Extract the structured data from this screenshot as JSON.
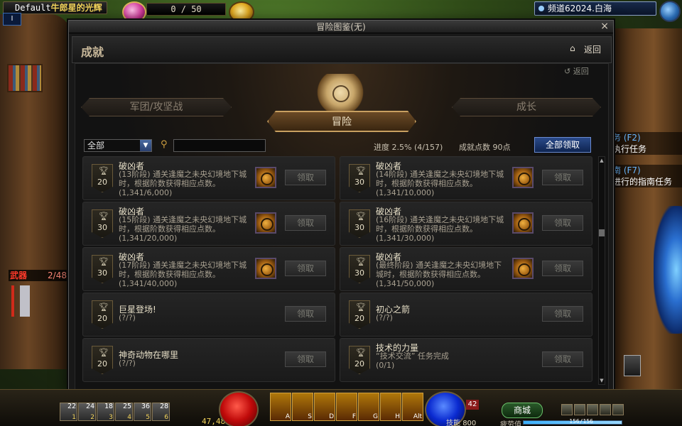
{
  "hud": {
    "player_name": "Default",
    "player_title": "牛郎星的光辉",
    "level": "I",
    "fatigue": "0 / 50",
    "channel": "频道62024.白海"
  },
  "quest": {
    "header1": "务 (F2)",
    "text1": "执行任务",
    "header2": "南 (F7)",
    "text2": "进行的指南任务"
  },
  "weapon": {
    "label": "武器",
    "count": "2/48"
  },
  "window": {
    "title": "冒险图鉴(无)",
    "close": "×",
    "section": "成就",
    "back": "返回",
    "back_small": "返回"
  },
  "categories": {
    "left": "军团/攻坚战",
    "center": "冒险",
    "right": "成长"
  },
  "filter": {
    "selected": "全部",
    "search_placeholder": ""
  },
  "progress": {
    "label": "进度",
    "percent": "2.5%",
    "fraction": "(4/157)",
    "points_label": "成就点数",
    "points": "90点"
  },
  "claim_all": "全部领取",
  "achievements": [
    {
      "name": "破凶者",
      "desc": "(13阶段) 通关逢魔之未央幻境地下城时，根据阶数获得相应点数。",
      "progress": "(1,341/6,000)",
      "points": "20",
      "has_reward": true,
      "claim": "领取"
    },
    {
      "name": "破凶者",
      "desc": "(14阶段) 通关逢魔之未央幻境地下城时，根据阶数获得相应点数。",
      "progress": "(1,341/10,000)",
      "points": "30",
      "has_reward": true,
      "claim": "领取"
    },
    {
      "name": "破凶者",
      "desc": "(15阶段) 通关逢魔之未央幻境地下城时，根据阶数获得相应点数。",
      "progress": "(1,341/20,000)",
      "points": "30",
      "has_reward": true,
      "claim": "领取"
    },
    {
      "name": "破凶者",
      "desc": "(16阶段) 通关逢魔之未央幻境地下城时，根据阶数获得相应点数。",
      "progress": "(1,341/30,000)",
      "points": "30",
      "has_reward": true,
      "claim": "领取"
    },
    {
      "name": "破凶者",
      "desc": "(17阶段) 通关逢魔之未央幻境地下城时，根据阶数获得相应点数。",
      "progress": "(1,341/40,000)",
      "points": "30",
      "has_reward": true,
      "claim": "领取"
    },
    {
      "name": "破凶者",
      "desc": "(最终阶段) 通关逢魔之未央幻境地下城时，根据阶数获得相应点数。",
      "progress": "(1,341/50,000)",
      "points": "30",
      "has_reward": true,
      "claim": "领取"
    },
    {
      "name": "巨星登场!",
      "desc": "",
      "progress": "(?/?)",
      "points": "20",
      "has_reward": false,
      "claim": "领取"
    },
    {
      "name": "初心之箭",
      "desc": "",
      "progress": "(?/?)",
      "points": "20",
      "has_reward": false,
      "claim": "领取"
    },
    {
      "name": "神奇动物在哪里",
      "desc": "",
      "progress": "(?/?)",
      "points": "20",
      "has_reward": false,
      "claim": "领取"
    },
    {
      "name": "技术的力量",
      "desc": "“技术交流” 任务完成",
      "progress": "(0/1)",
      "points": "20",
      "has_reward": false,
      "claim": "领取"
    }
  ],
  "bottom": {
    "quick_slots": [
      {
        "count": "22",
        "key": "1"
      },
      {
        "count": "24",
        "key": "2"
      },
      {
        "count": "18",
        "key": "3"
      },
      {
        "count": "25",
        "key": "4"
      },
      {
        "count": "36",
        "key": "5"
      },
      {
        "count": "28",
        "key": "6"
      }
    ],
    "gold": "47,480",
    "skill_keys": [
      "A",
      "S",
      "D",
      "F",
      "G",
      "H",
      "Alt"
    ],
    "skill_points_label": "技能",
    "skill_points": "800",
    "notice_count": "42",
    "shop": "商城",
    "fatigue_label": "疲劳值",
    "fatigue_value": "156/156",
    "fatigue_fraction": 1.0
  }
}
